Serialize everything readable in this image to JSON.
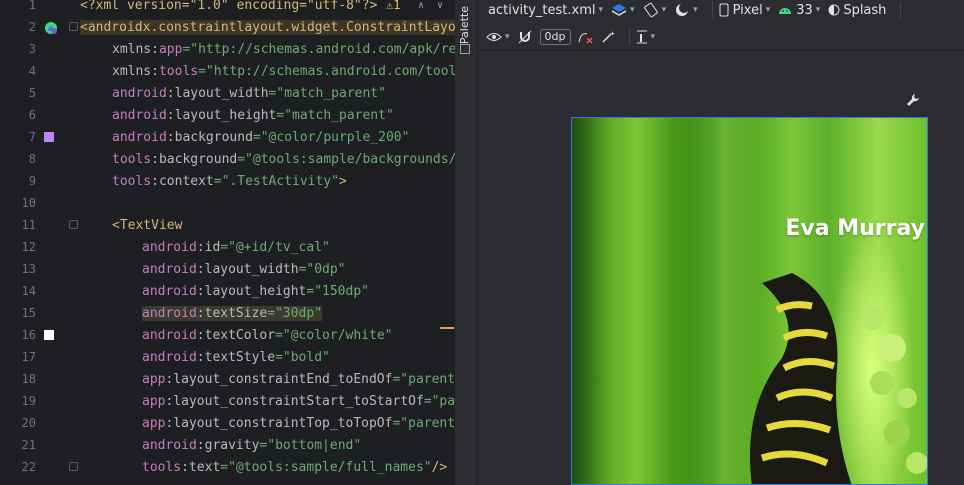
{
  "editor": {
    "lines": [
      {
        "n": "1"
      },
      {
        "n": "2"
      },
      {
        "n": "3"
      },
      {
        "n": "4"
      },
      {
        "n": "5"
      },
      {
        "n": "6"
      },
      {
        "n": "7"
      },
      {
        "n": "8"
      },
      {
        "n": "9"
      },
      {
        "n": "10"
      },
      {
        "n": "11"
      },
      {
        "n": "12"
      },
      {
        "n": "13"
      },
      {
        "n": "14"
      },
      {
        "n": "15"
      },
      {
        "n": "16"
      },
      {
        "n": "17"
      },
      {
        "n": "18"
      },
      {
        "n": "19"
      },
      {
        "n": "20"
      },
      {
        "n": "21"
      },
      {
        "n": "22"
      }
    ],
    "code": {
      "l1_prolog": "<?xml version=\"1.0\" encoding=\"utf-8\"?>",
      "l1_warn": "⚠1",
      "l2_tag": "<androidx.constraintlayout.widget.ConstraintLayo",
      "l3_ns": "xmlns:",
      "l3_attr": "app",
      "l3_val": "=\"http://schemas.android.com/apk/re",
      "l4_ns": "xmlns:",
      "l4_attr": "tools",
      "l4_val": "=\"http://schemas.android.com/tool",
      "l5_ns": "android",
      "l5_attr": ":layout_width",
      "l5_val": "=\"match_parent\"",
      "l6_ns": "android",
      "l6_attr": ":layout_height",
      "l6_val": "=\"match_parent\"",
      "l7_ns": "android",
      "l7_attr": ":background",
      "l7_val": "=\"@color/purple_200\"",
      "l8_ns": "tools",
      "l8_attr": ":background",
      "l8_val": "=\"@tools:sample/backgrounds/",
      "l9_ns": "tools",
      "l9_attr": ":context",
      "l9_val": "=\".TestActivity\"",
      "l9_end": ">",
      "l11_tag": "<TextView",
      "l12_ns": "android",
      "l12_attr": ":id",
      "l12_val": "=\"@+id/tv_cal\"",
      "l13_ns": "android",
      "l13_attr": ":layout_width",
      "l13_val": "=\"0dp\"",
      "l14_ns": "android",
      "l14_attr": ":layout_height",
      "l14_val": "=\"150dp\"",
      "l15_ns": "android",
      "l15_attr": ":textSize",
      "l15_val": "=\"30dp\"",
      "l16_ns": "android",
      "l16_attr": ":textColor",
      "l16_val": "=\"@color/white\"",
      "l17_ns": "android",
      "l17_attr": ":textStyle",
      "l17_val": "=\"bold\"",
      "l18_ns": "app",
      "l18_attr": ":layout_constraintEnd_toEndOf",
      "l18_val": "=\"parent",
      "l19_ns": "app",
      "l19_attr": ":layout_constraintStart_toStartOf",
      "l19_val": "=\"pa",
      "l20_ns": "app",
      "l20_attr": ":layout_constraintTop_toTopOf",
      "l20_val": "=\"parent",
      "l21_ns": "android",
      "l21_attr": ":gravity",
      "l21_val": "=\"bottom|end\"",
      "l22_ns": "tools",
      "l22_attr": ":text",
      "l22_val": "=\"@tools:sample/full_names\"",
      "l22_end": "/>"
    }
  },
  "palette": {
    "label": "Palette"
  },
  "toolbar": {
    "file_name": "activity_test.xml",
    "device": "Pixel",
    "api": "33",
    "theme": "Splash",
    "margin_value": "0dp"
  },
  "preview": {
    "text": "Eva Murray"
  },
  "colors": {
    "accent_selection": "#3574f0",
    "purple_swatch": "#bb86fc",
    "white_swatch": "#ffffff"
  },
  "icons": {
    "layers": "layers-icon",
    "rotate": "rotate-icon",
    "night": "night-mode-icon",
    "phone": "phone-icon",
    "android": "android-icon",
    "theme": "theme-icon",
    "eye": "eye-icon",
    "magnet": "magnet-icon",
    "clear": "clear-constraints-icon",
    "magic": "magic-wand-icon",
    "align": "align-icon",
    "wrench": "wrench-icon"
  }
}
